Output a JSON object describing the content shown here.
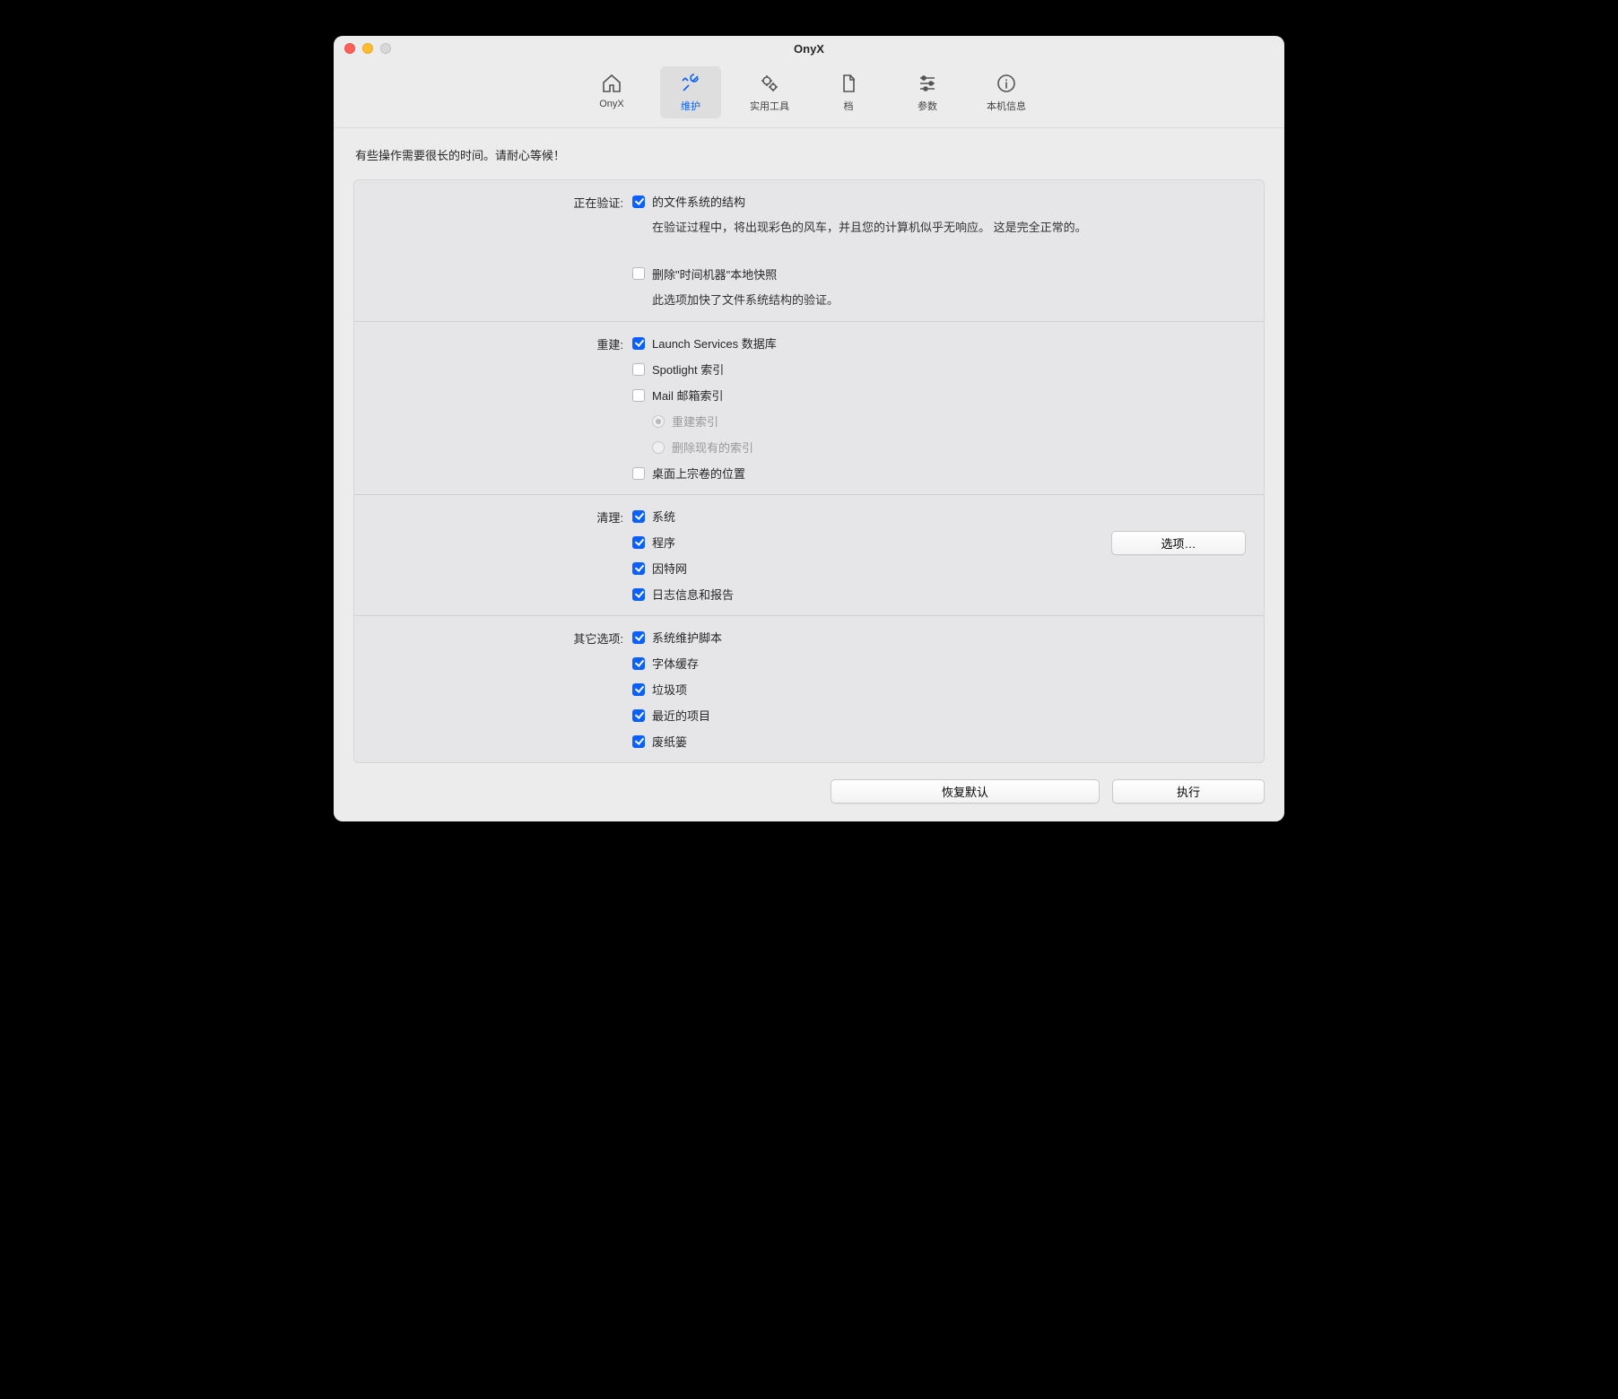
{
  "window": {
    "title": "OnyX"
  },
  "toolbar": {
    "items": [
      {
        "label": "OnyX"
      },
      {
        "label": "维护"
      },
      {
        "label": "实用工具"
      },
      {
        "label": "档"
      },
      {
        "label": "参数"
      },
      {
        "label": "本机信息"
      }
    ],
    "active_index": 1
  },
  "notice": "有些操作需要很长的时间。请耐心等候！",
  "sections": {
    "verify": {
      "label": "正在验证:",
      "fs_structure": {
        "label": "的文件系统的结构",
        "checked": true
      },
      "fs_desc": "在验证过程中，将出现彩色的风车，并且您的计算机似乎无响应。 这是完全正常的。",
      "tm_delete": {
        "label": "删除\"时间机器\"本地快照",
        "checked": false
      },
      "tm_desc": "此选项加快了文件系统结构的验证。"
    },
    "rebuild": {
      "label": "重建:",
      "launch_services": {
        "label": "Launch Services 数据库",
        "checked": true
      },
      "spotlight": {
        "label": "Spotlight 索引",
        "checked": false
      },
      "mail": {
        "label": "Mail 邮箱索引",
        "checked": false
      },
      "mail_radios": {
        "rebuild": {
          "label": "重建索引",
          "checked": true
        },
        "delete": {
          "label": "删除现有的索引",
          "checked": false
        }
      },
      "desktop_volumes": {
        "label": "桌面上宗卷的位置",
        "checked": false
      }
    },
    "clean": {
      "label": "清理:",
      "system": {
        "label": "系统",
        "checked": true
      },
      "apps": {
        "label": "程序",
        "checked": true
      },
      "internet": {
        "label": "因特网",
        "checked": true
      },
      "logs": {
        "label": "日志信息和报告",
        "checked": true
      },
      "options_button": "选项…"
    },
    "other": {
      "label": "其它选项:",
      "maint_scripts": {
        "label": "系统维护脚本",
        "checked": true
      },
      "font_cache": {
        "label": "字体缓存",
        "checked": true
      },
      "junk": {
        "label": "垃圾项",
        "checked": true
      },
      "recent": {
        "label": "最近的项目",
        "checked": true
      },
      "trash": {
        "label": "废纸篓",
        "checked": true
      }
    }
  },
  "footer": {
    "restore_defaults": "恢复默认",
    "execute": "执行"
  }
}
